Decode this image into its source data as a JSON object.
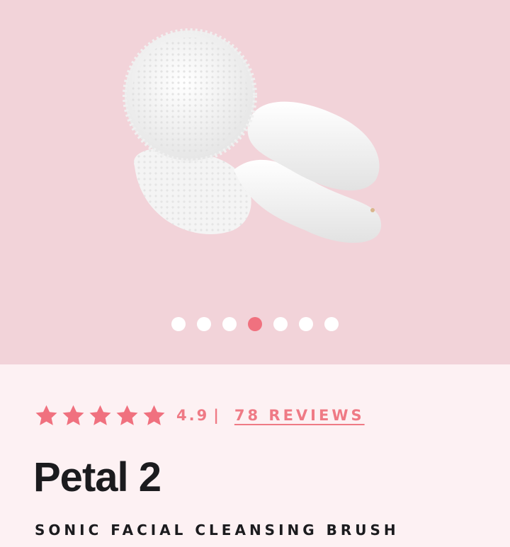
{
  "gallery": {
    "image_alt": "Petal 2 white silicone sonic facial cleansing brush",
    "background_color": "#f2d3d9",
    "dots_count": 7,
    "active_dot_index": 3
  },
  "rating": {
    "stars": 5,
    "value": "4.9",
    "separator": "|",
    "reviews_label": "78 REVIEWS",
    "star_color": "#f0717f"
  },
  "product": {
    "name": "Petal 2",
    "subtitle": "SONIC FACIAL CLEANSING BRUSH"
  }
}
